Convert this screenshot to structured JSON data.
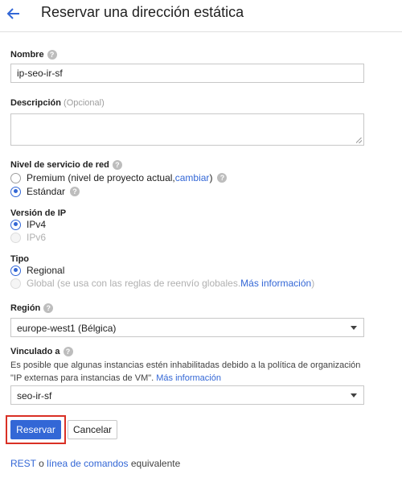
{
  "header": {
    "title": "Reservar una dirección estática",
    "back_icon": "arrow-left-icon"
  },
  "form": {
    "name": {
      "label": "Nombre",
      "value": "ip-seo-ir-sf"
    },
    "description": {
      "label": "Descripción",
      "optional": "(Opcional)",
      "value": ""
    },
    "network_tier": {
      "label": "Nivel de servicio de red",
      "premium": {
        "label": "Premium (nivel de proyecto actual, ",
        "link": "cambiar",
        "suffix": ")"
      },
      "standard": {
        "label": "Estándar"
      },
      "selected": "standard"
    },
    "ip_version": {
      "label": "Versión de IP",
      "ipv4": "IPv4",
      "ipv6": "IPv6",
      "selected": "ipv4"
    },
    "type": {
      "label": "Tipo",
      "regional": "Regional",
      "global": {
        "label": "Global (se usa con las reglas de reenvío globales. ",
        "link": "Más información",
        "suffix": ")"
      },
      "selected": "regional"
    },
    "region": {
      "label": "Región",
      "value": "europe-west1 (Bélgica)"
    },
    "attached_to": {
      "label": "Vinculado a",
      "note_line1": "Es posible que algunas instancias estén inhabilitadas debido a la política de organización",
      "note_line2": "\"IP externas para instancias de VM\". ",
      "note_link": "Más información",
      "value": "seo-ir-sf"
    }
  },
  "actions": {
    "reserve": "Reservar",
    "cancel": "Cancelar"
  },
  "footer": {
    "rest": "REST",
    "or": " o ",
    "cli": "línea de comandos",
    "suffix": " equivalente"
  },
  "colors": {
    "accent": "#3367d6",
    "highlight": "#d93025"
  }
}
